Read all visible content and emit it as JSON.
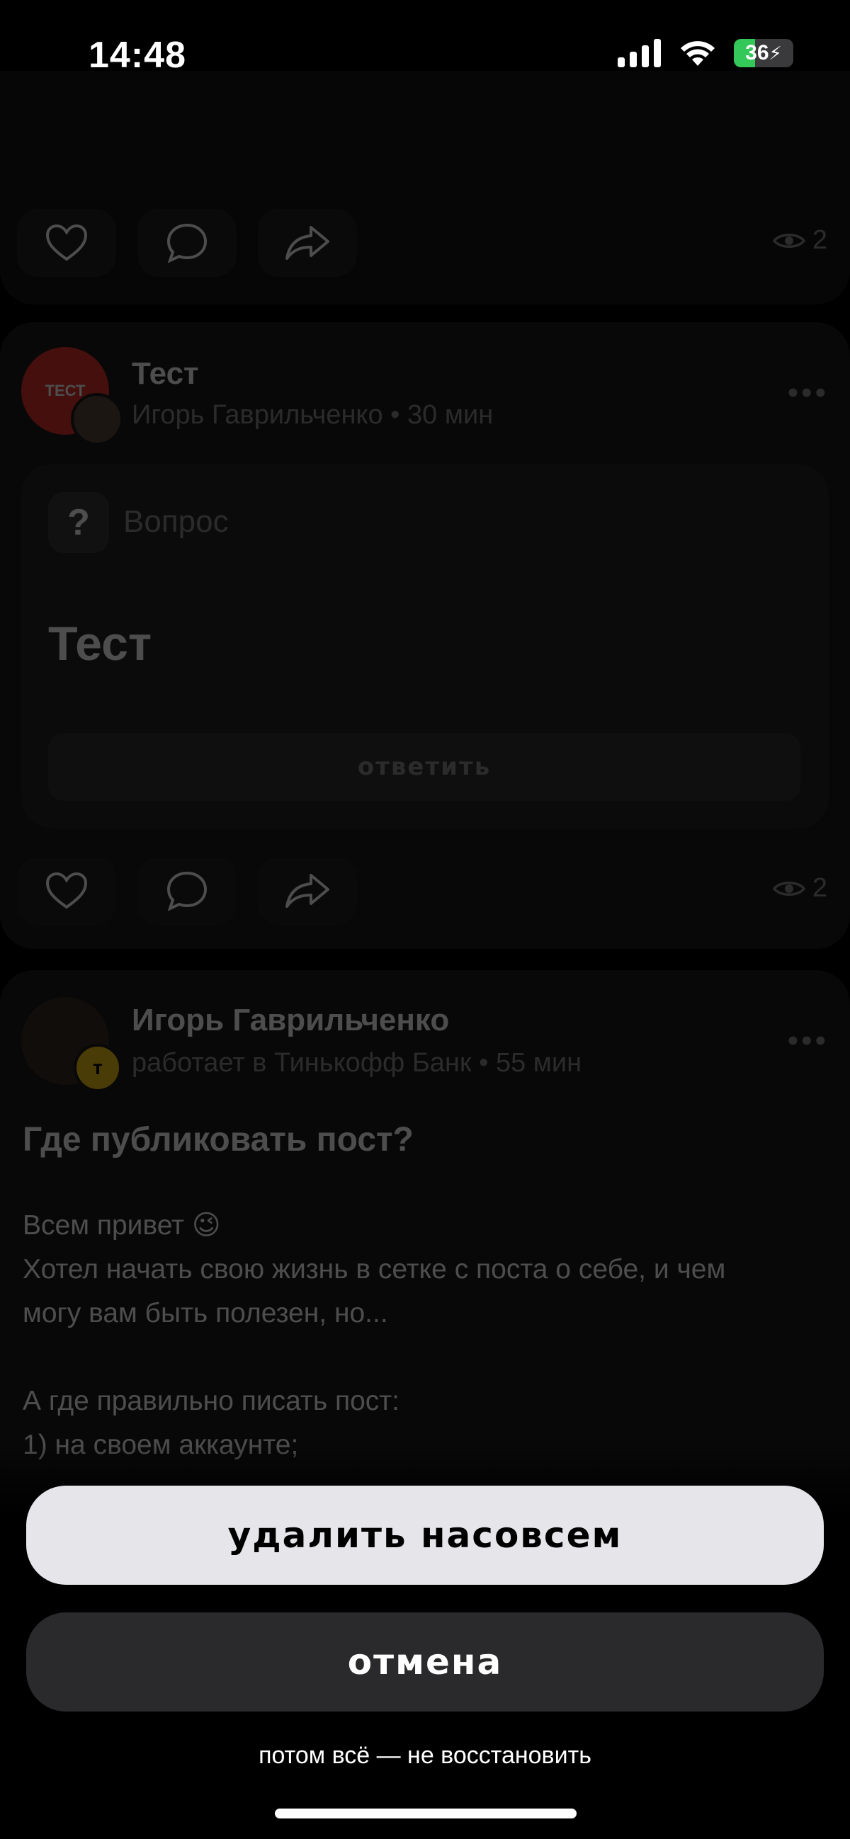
{
  "status_bar": {
    "time": "14:48",
    "battery": "36"
  },
  "feed": {
    "post1": {
      "views": "2"
    },
    "post2": {
      "avatar_text": "ТЕСТ",
      "title": "Тест",
      "meta": "Игорь Гаврильченко • 30 мин",
      "poll_label": "Вопрос",
      "poll_question": "Тест",
      "answer_button": "ответить",
      "views": "2"
    },
    "post3": {
      "author": "Игорь Гаврильченко",
      "meta": "работает в Тинькофф Банк • 55 мин",
      "badge": "т",
      "title": "Где публиковать пост?",
      "body": [
        "Всем привет 😉",
        "Хотел начать свою жизнь в сетке с поста о себе, и чем",
        "могу вам быть полезен, но...",
        "",
        "А где правильно писать пост:",
        "1) на своем аккаунте;"
      ]
    }
  },
  "sheet": {
    "delete_label": "удалить насовсем",
    "cancel_label": "отмена",
    "note": "потом всё — не восстановить"
  },
  "colors": {
    "delete_bg": "#e5e5ea",
    "cancel_bg": "#2a2a2c",
    "accent_red": "#e0322d",
    "badge_yellow": "#f5c518"
  }
}
